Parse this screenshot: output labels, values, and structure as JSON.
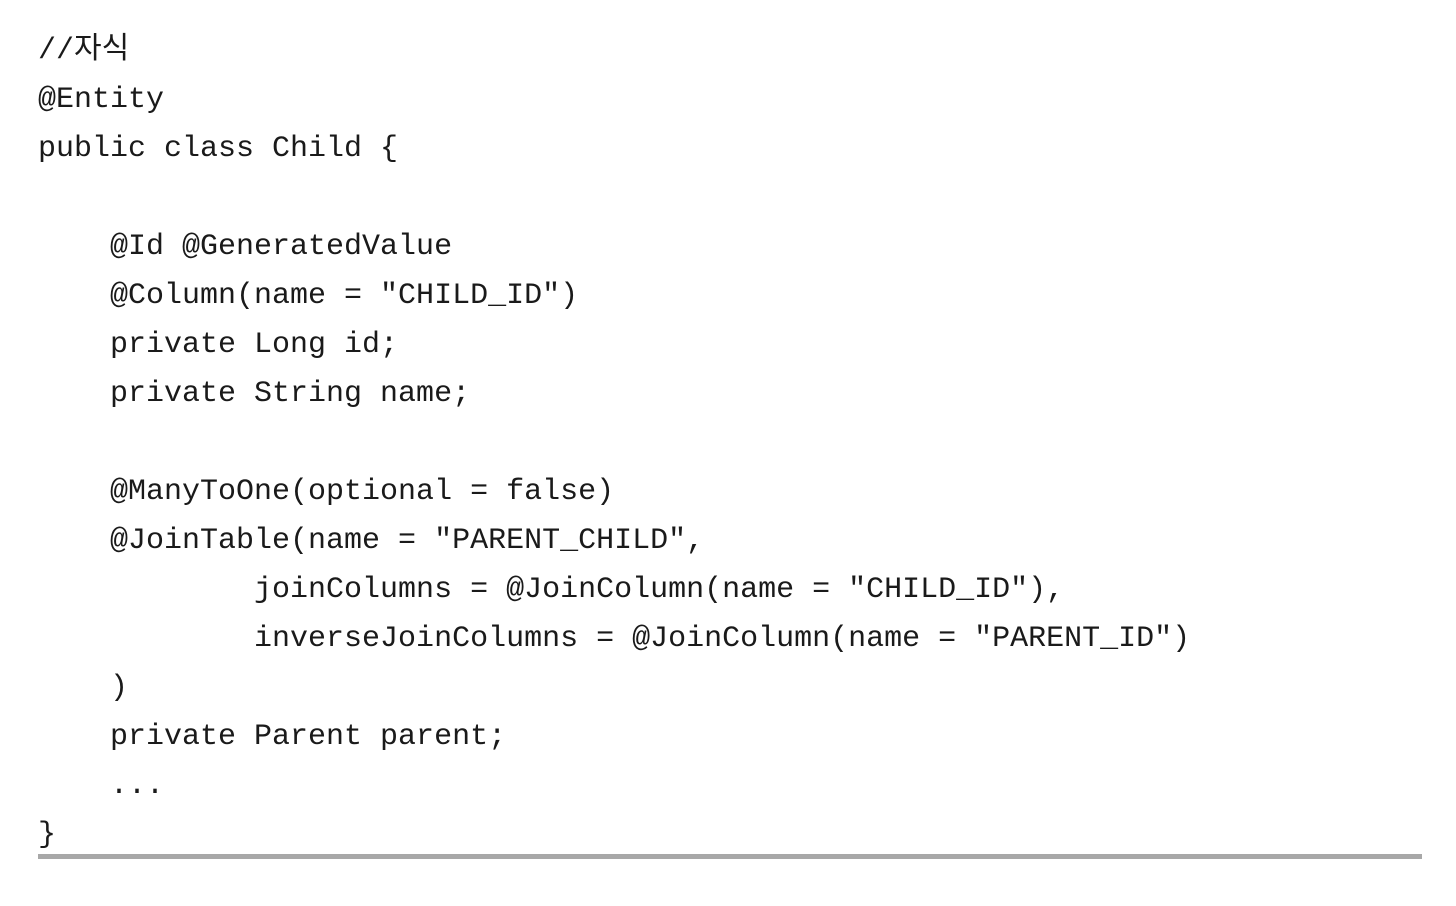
{
  "document": {
    "type": "code-snippet",
    "language": "java",
    "background_color": "#ffffff",
    "text_color": "#1a1a1a",
    "divider_color": "#a8a8a8"
  },
  "code": {
    "lines": [
      {
        "text": "//자식",
        "indent": 0,
        "blank": false
      },
      {
        "text": "@Entity",
        "indent": 0,
        "blank": false
      },
      {
        "text": "public class Child {",
        "indent": 0,
        "blank": false
      },
      {
        "text": "",
        "indent": 0,
        "blank": true
      },
      {
        "text": "    @Id @GeneratedValue",
        "indent": 1,
        "blank": false
      },
      {
        "text": "    @Column(name = \"CHILD_ID\")",
        "indent": 1,
        "blank": false
      },
      {
        "text": "    private Long id;",
        "indent": 1,
        "blank": false
      },
      {
        "text": "    private String name;",
        "indent": 1,
        "blank": false
      },
      {
        "text": "",
        "indent": 0,
        "blank": true
      },
      {
        "text": "    @ManyToOne(optional = false)",
        "indent": 1,
        "blank": false
      },
      {
        "text": "    @JoinTable(name = \"PARENT_CHILD\",",
        "indent": 1,
        "blank": false
      },
      {
        "text": "            joinColumns = @JoinColumn(name = \"CHILD_ID\"),",
        "indent": 3,
        "blank": false
      },
      {
        "text": "            inverseJoinColumns = @JoinColumn(name = \"PARENT_ID\")",
        "indent": 3,
        "blank": false
      },
      {
        "text": "    )",
        "indent": 1,
        "blank": false
      },
      {
        "text": "    private Parent parent;",
        "indent": 1,
        "blank": false
      },
      {
        "text": "    ...",
        "indent": 1,
        "blank": false
      },
      {
        "text": "}",
        "indent": 0,
        "blank": false
      }
    ]
  },
  "divider": {
    "visible": true,
    "color": "#a8a8a8"
  }
}
